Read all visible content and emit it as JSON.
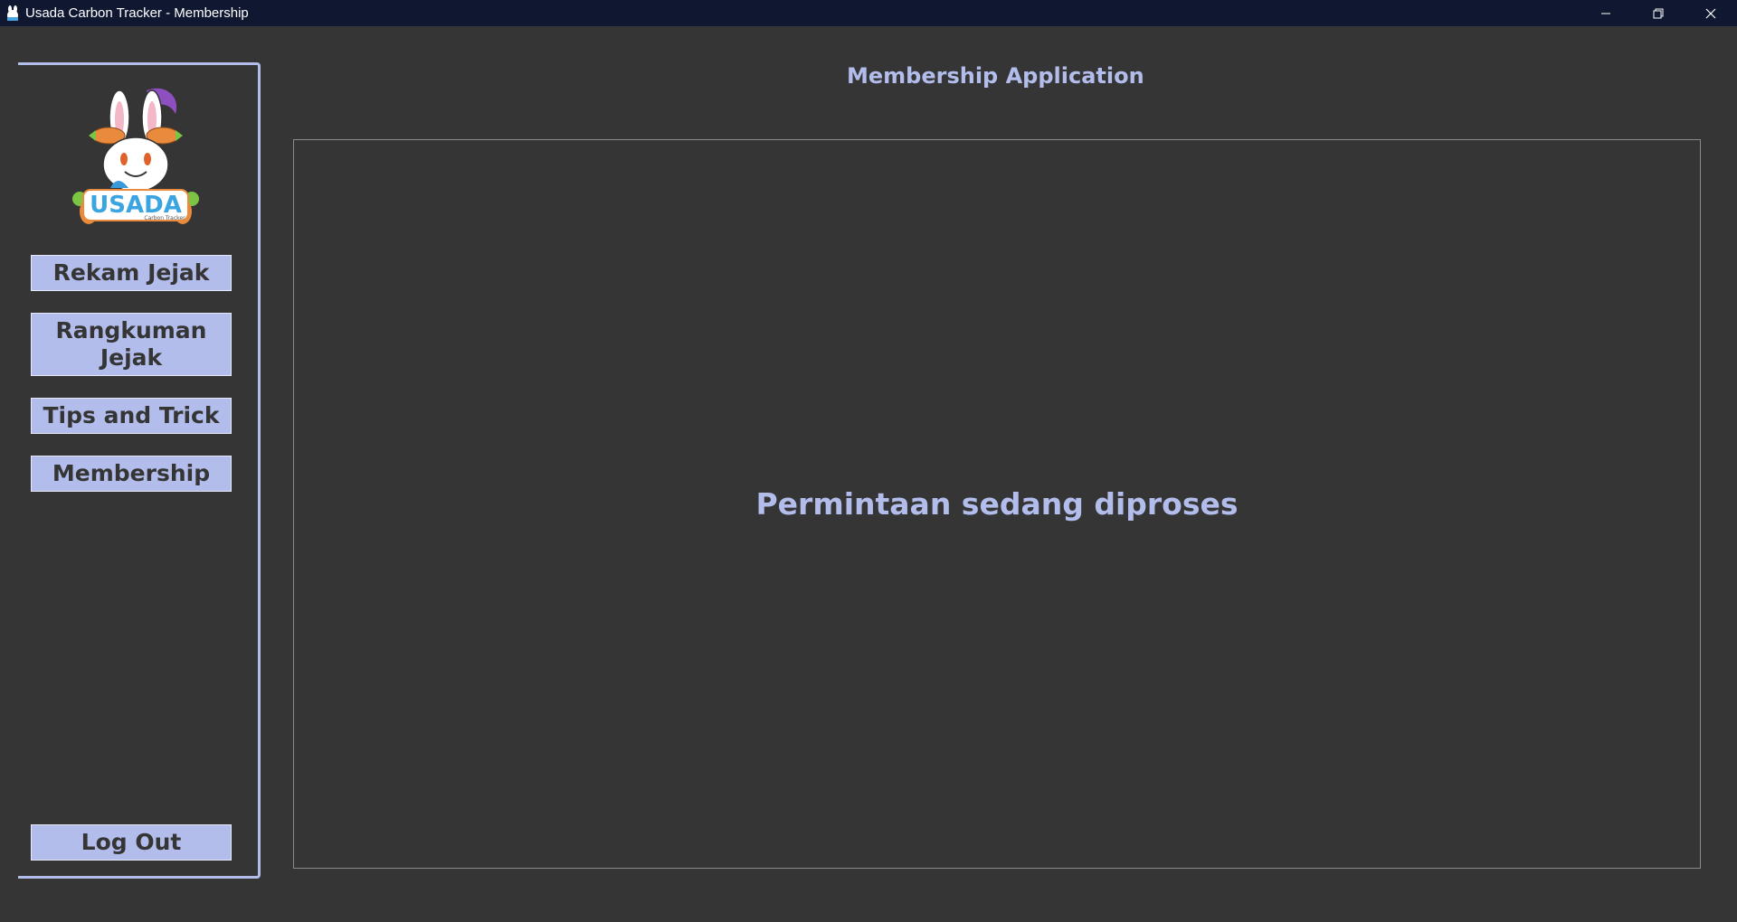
{
  "window": {
    "title": "Usada Carbon Tracker - Membership",
    "controls": [
      "minimize-icon",
      "restore-icon",
      "close-icon"
    ]
  },
  "sidebar": {
    "logo_text": "USADA",
    "logo_subtext": "Carbon Tracker",
    "items": [
      {
        "label": "Rekam Jejak"
      },
      {
        "label": "Rangkuman Jejak"
      },
      {
        "label": "Tips and Trick"
      },
      {
        "label": "Membership"
      }
    ],
    "logout_label": "Log Out"
  },
  "main": {
    "heading": "Membership Application",
    "status_message": "Permintaan sedang diproses"
  },
  "colors": {
    "background": "#353535",
    "accent": "#b3bdec",
    "titlebar": "#0f1731"
  }
}
